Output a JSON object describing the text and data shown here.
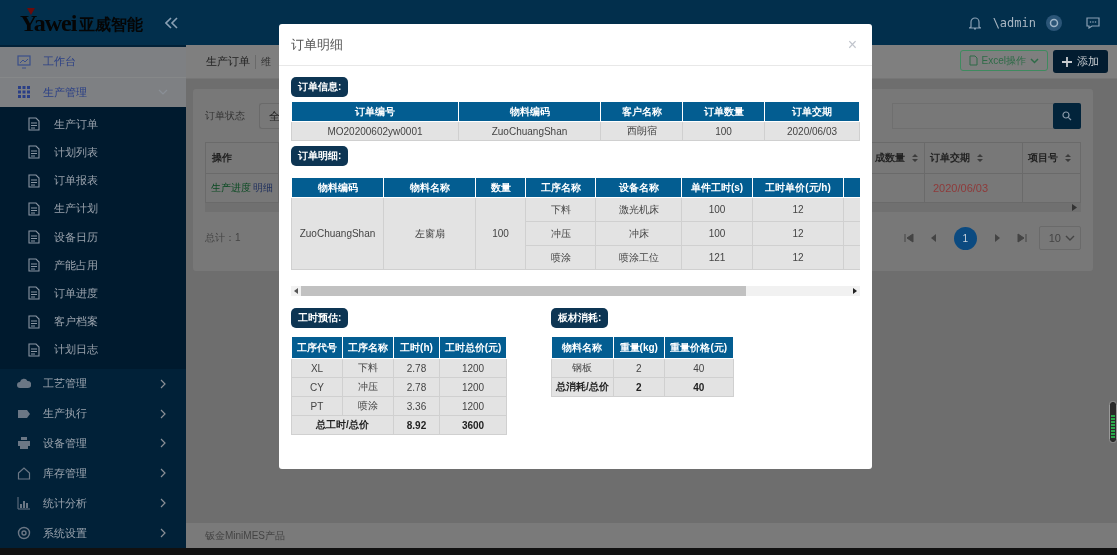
{
  "header": {
    "logo": {
      "wordmark": "Yawei",
      "name": "亚威智能"
    },
    "user": "\\admin"
  },
  "sidebar": {
    "items": [
      {
        "label": "工作台"
      },
      {
        "label": "生产管理",
        "expanded": true,
        "children": [
          {
            "label": "生产订单"
          },
          {
            "label": "计划列表"
          },
          {
            "label": "订单报表"
          },
          {
            "label": "生产计划"
          },
          {
            "label": "设备日历"
          },
          {
            "label": "产能占用"
          },
          {
            "label": "订单进度"
          },
          {
            "label": "客户档案"
          },
          {
            "label": "计划日志"
          }
        ]
      },
      {
        "label": "工艺管理",
        "expanded": false
      },
      {
        "label": "生产执行",
        "expanded": false
      },
      {
        "label": "设备管理",
        "expanded": false
      },
      {
        "label": "库存管理",
        "expanded": false
      },
      {
        "label": "统计分析",
        "expanded": false
      },
      {
        "label": "系统设置",
        "expanded": false
      }
    ]
  },
  "page": {
    "tabs": [
      "生产订单",
      "维"
    ],
    "excel_button": "Excel操作",
    "add_button": "添加",
    "filter": {
      "label": "订单状态",
      "value": "全"
    },
    "table": {
      "columns": [
        "操作",
        "成数量",
        "订单交期",
        "项目号"
      ],
      "rows": [
        {
          "actions": [
            "生产进度",
            "明细"
          ],
          "delivery": "2020/06/03"
        }
      ]
    },
    "total": "总计：1",
    "pagination": {
      "pages": [
        {
          "label": "1",
          "selected": true
        }
      ],
      "page_size": "10"
    }
  },
  "footer": "钣金MiniMES产品",
  "modal": {
    "title": "订单明细",
    "close": "×",
    "order_info": {
      "badge": "订单信息:",
      "columns": [
        "订单编号",
        "物料编码",
        "客户名称",
        "订单数量",
        "订单交期"
      ],
      "row": [
        "MO20200602yw0001",
        "ZuoChuangShan",
        "西朗宿",
        "100",
        "2020/06/03"
      ]
    },
    "order_detail": {
      "badge": "订单明细:",
      "columns": [
        "物料编码",
        "物料名称",
        "数量",
        "工序名称",
        "设备名称",
        "单件工时(s)",
        "工时单价(元/h)"
      ],
      "material_code": "ZuoChuangShan",
      "material_name": "左窗扇",
      "quantity": "100",
      "processes": [
        {
          "name": "下料",
          "device": "激光机床",
          "unit_time": "100",
          "unit_price": "12"
        },
        {
          "name": "冲压",
          "device": "冲床",
          "unit_time": "100",
          "unit_price": "12"
        },
        {
          "name": "喷涂",
          "device": "喷涂工位",
          "unit_time": "121",
          "unit_price": "12"
        }
      ]
    },
    "hours_estimate": {
      "badge": "工时预估:",
      "columns": [
        "工序代号",
        "工序名称",
        "工时(h)",
        "工时总价(元)"
      ],
      "rows": [
        [
          "XL",
          "下料",
          "2.78",
          "1200"
        ],
        [
          "CY",
          "冲压",
          "2.78",
          "1200"
        ],
        [
          "PT",
          "喷涂",
          "3.36",
          "1200"
        ]
      ],
      "total": {
        "label": "总工时/总价",
        "hours": "8.92",
        "price": "3600"
      }
    },
    "sheet_usage": {
      "badge": "板材消耗:",
      "columns": [
        "物料名称",
        "重量(kg)",
        "重量价格(元)"
      ],
      "rows": [
        [
          "钢板",
          "2",
          "40"
        ]
      ],
      "total": {
        "label": "总消耗/总价",
        "weight": "2",
        "price": "40"
      }
    }
  }
}
